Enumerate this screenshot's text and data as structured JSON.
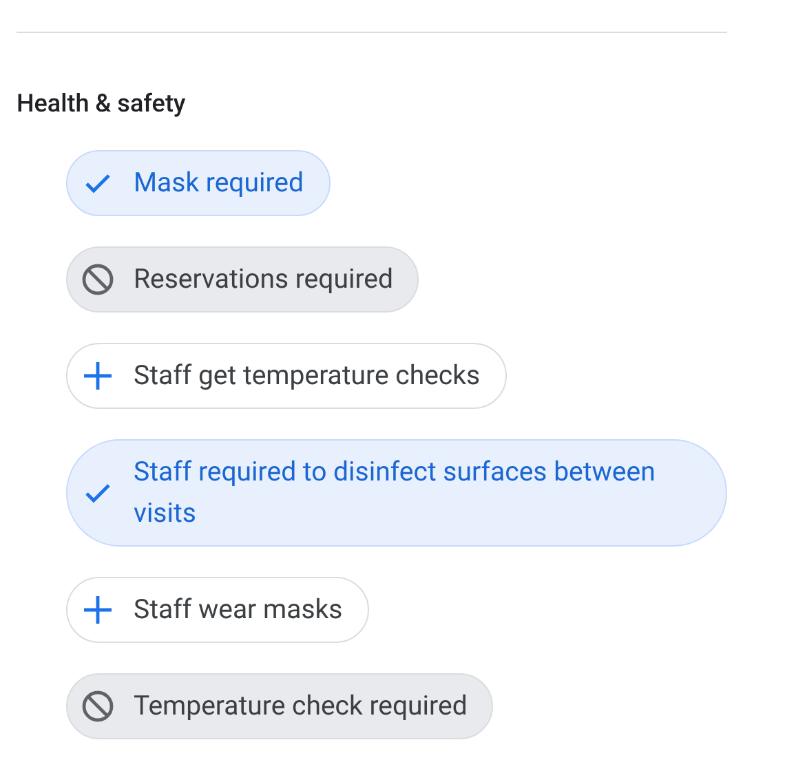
{
  "section": {
    "title": "Health & safety"
  },
  "chips": [
    {
      "label": "Mask required",
      "kind": "yes"
    },
    {
      "label": "Reservations required",
      "kind": "no"
    },
    {
      "label": "Staff get temperature checks",
      "kind": "add"
    },
    {
      "label": "Staff required to disinfect surfaces between visits",
      "kind": "yes"
    },
    {
      "label": "Staff wear masks",
      "kind": "add"
    },
    {
      "label": "Temperature check required",
      "kind": "no"
    }
  ]
}
